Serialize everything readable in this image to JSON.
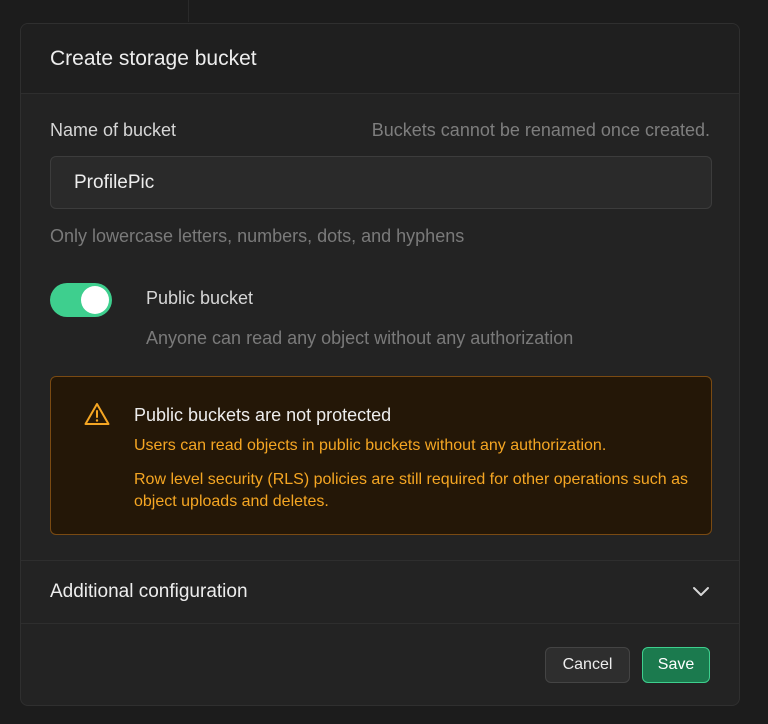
{
  "dialog": {
    "title": "Create storage bucket"
  },
  "name_field": {
    "label": "Name of bucket",
    "hint": "Buckets cannot be renamed once created.",
    "value": "ProfilePic",
    "help": "Only lowercase letters, numbers, dots, and hyphens"
  },
  "public_toggle": {
    "checked": true,
    "label": "Public bucket",
    "description": "Anyone can read any object without any authorization"
  },
  "alert": {
    "icon": "warning-triangle-icon",
    "title": "Public buckets are not protected",
    "line1": "Users can read objects in public buckets without any authorization.",
    "line2": "Row level security (RLS) policies are still required for other operations such as object uploads and deletes."
  },
  "additional": {
    "label": "Additional configuration",
    "icon": "chevron-down-icon"
  },
  "footer": {
    "cancel_label": "Cancel",
    "save_label": "Save"
  },
  "colors": {
    "accent": "#3ecf8e",
    "warning": "#f5a623",
    "background": "#1c1c1c",
    "panel": "#232323"
  }
}
